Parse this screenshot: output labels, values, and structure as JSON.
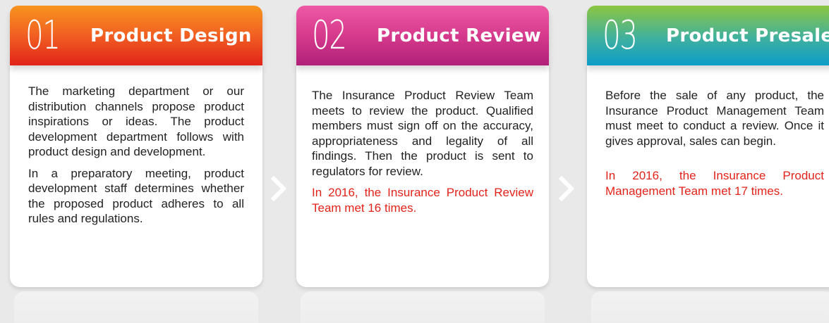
{
  "cards": [
    {
      "number": "01",
      "title": "Product Design",
      "paragraphs": [
        "The marketing department or our distribution channels propose product inspirations or ideas. The product development department follows with product design and development.",
        "In a preparatory meeting, product development staff determines whether the proposed product adheres to all rules and regulations."
      ],
      "note": ""
    },
    {
      "number": "02",
      "title": "Product Review",
      "paragraphs": [
        "The Insurance Product Review Team meets to review the product. Qualified members must sign off on the accuracy, appropriateness and legality of all findings. Then the product is sent to regulators for review."
      ],
      "note": "In 2016, the Insurance Product Review Team met 16 times."
    },
    {
      "number": "03",
      "title": "Product Presale",
      "paragraphs": [
        "Before the sale of any product, the Insurance Product Management Team must meet to conduct a review. Once it gives approval, sales can begin."
      ],
      "note": "In 2016, the Insurance Product Management Team met 17 times."
    }
  ],
  "colors": {
    "background": "#e9e9e9",
    "note_text": "#e2231a",
    "card1_header": "#f26522",
    "card2_header": "#d63a8c",
    "card3_header": "#3fb0a0",
    "arrow": "#ffffff"
  },
  "icons": {
    "step_arrow": "chevron-right-icon"
  }
}
